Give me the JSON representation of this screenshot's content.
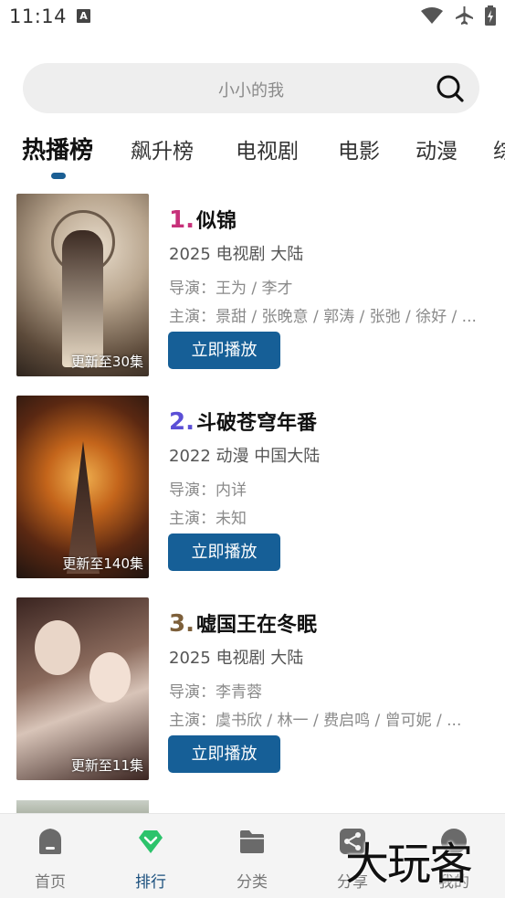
{
  "status_bar": {
    "time": "11:14",
    "notification_letter": "A"
  },
  "search": {
    "text": "小小的我"
  },
  "tabs": [
    {
      "label": "热播榜",
      "active": true
    },
    {
      "label": "飙升榜"
    },
    {
      "label": "电视剧"
    },
    {
      "label": "电影"
    },
    {
      "label": "动漫"
    },
    {
      "label": "综"
    }
  ],
  "items": [
    {
      "rank": "1.",
      "rank_color": "#c7317a",
      "title": "似锦",
      "meta": "2025  电视剧  大陆",
      "director": "导演：王为 / 李才",
      "cast": "主演：景甜 / 张晚意 / 郭涛 / 张弛 / 徐好 / ...",
      "badge": "更新至30集",
      "play_label": "立即播放",
      "poster_colors": [
        "#d9cbb8",
        "#9a8a75",
        "#3d2f27"
      ]
    },
    {
      "rank": "2.",
      "rank_color": "#5b4fd6",
      "title": "斗破苍穹年番",
      "meta": "2022  动漫  中国大陆",
      "director": "导演：内详",
      "cast": "主演：未知",
      "badge": "更新至140集",
      "play_label": "立即播放",
      "poster_colors": [
        "#3a1e12",
        "#c4651b",
        "#1f1410"
      ]
    },
    {
      "rank": "3.",
      "rank_color": "#7d5f3a",
      "title": "嘘国王在冬眠",
      "meta": "2025  电视剧  大陆",
      "director": "导演：李青蓉",
      "cast": "主演：虞书欣 / 林一 / 费启鸣 / 曾可妮 / ...",
      "badge": "更新至11集",
      "play_label": "立即播放",
      "poster_colors": [
        "#4a2a24",
        "#b89a8a",
        "#2a1a18"
      ]
    }
  ],
  "bottom_nav": [
    {
      "label": "首页",
      "icon": "home-icon"
    },
    {
      "label": "排行",
      "icon": "ranking-icon",
      "active": true
    },
    {
      "label": "分类",
      "icon": "folder-icon"
    },
    {
      "label": "分享",
      "icon": "share-icon"
    },
    {
      "label": "我的",
      "icon": "profile-icon"
    }
  ],
  "watermark": "大玩客"
}
